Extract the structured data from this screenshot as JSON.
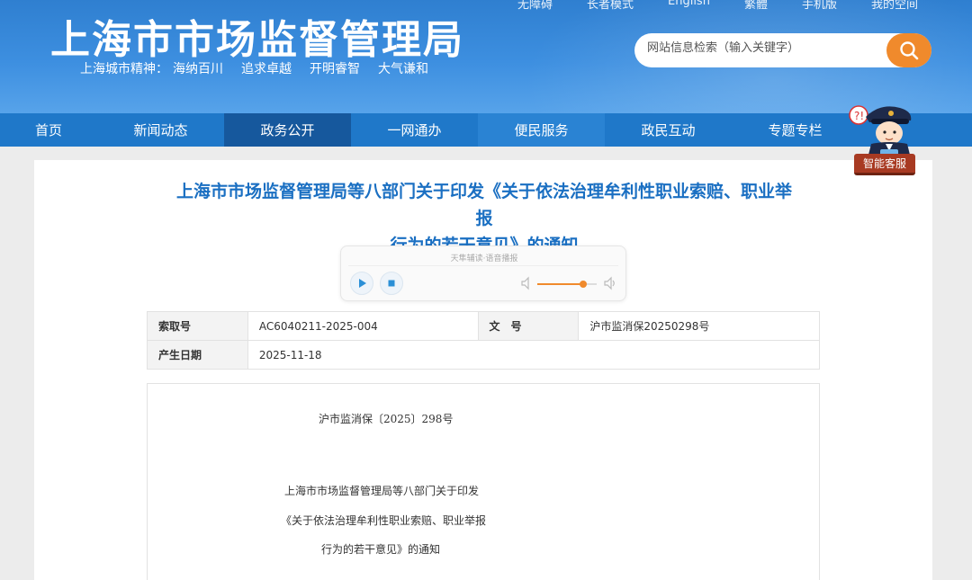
{
  "header": {
    "site_title": "上海市市场监督管理局",
    "slogan_label": "上海城市精神：",
    "slogan_items": [
      "海纳百川",
      "追求卓越",
      "开明睿智",
      "大气谦和"
    ],
    "top_links": [
      "无障碍",
      "长者模式",
      "English",
      "繁體",
      "手机版",
      "我的空间"
    ],
    "search": {
      "placeholder": "网站信息检索（输入关键字）"
    }
  },
  "nav": {
    "items": [
      "首页",
      "新闻动态",
      "政务公开",
      "一网通办",
      "便民服务",
      "政民互动",
      "专题专栏"
    ],
    "active_index": 2
  },
  "mascot": {
    "label": "智能客服"
  },
  "article": {
    "title_line1": "上海市市场监督管理局等八部门关于印发《关于依法治理牟利性职业索赔、职业举报",
    "title_line2": "行为的若干意见》的通知",
    "player_caption": "天隼辅读·语音播报",
    "volume_level": 0.78,
    "meta": {
      "index_label": "索取号",
      "index_value": "AC6040211-2025-004",
      "doc_label": "文　号",
      "doc_value": "沪市监消保20250298号",
      "date_label": "产生日期",
      "date_value": "2025-11-18"
    },
    "body": {
      "doc_number": "沪市监消保〔2025〕298号",
      "line1": "上海市市场监督管理局等八部门关于印发",
      "line2": "《关于依法治理牟利性职业索赔、职业举报",
      "line3": "行为的若干意见》的通知"
    }
  },
  "colors": {
    "header_blue": "#2f7fd0",
    "nav_blue": "#1f78c9",
    "title_blue": "#1a6fc2",
    "accent_orange": "#f08a2c"
  }
}
